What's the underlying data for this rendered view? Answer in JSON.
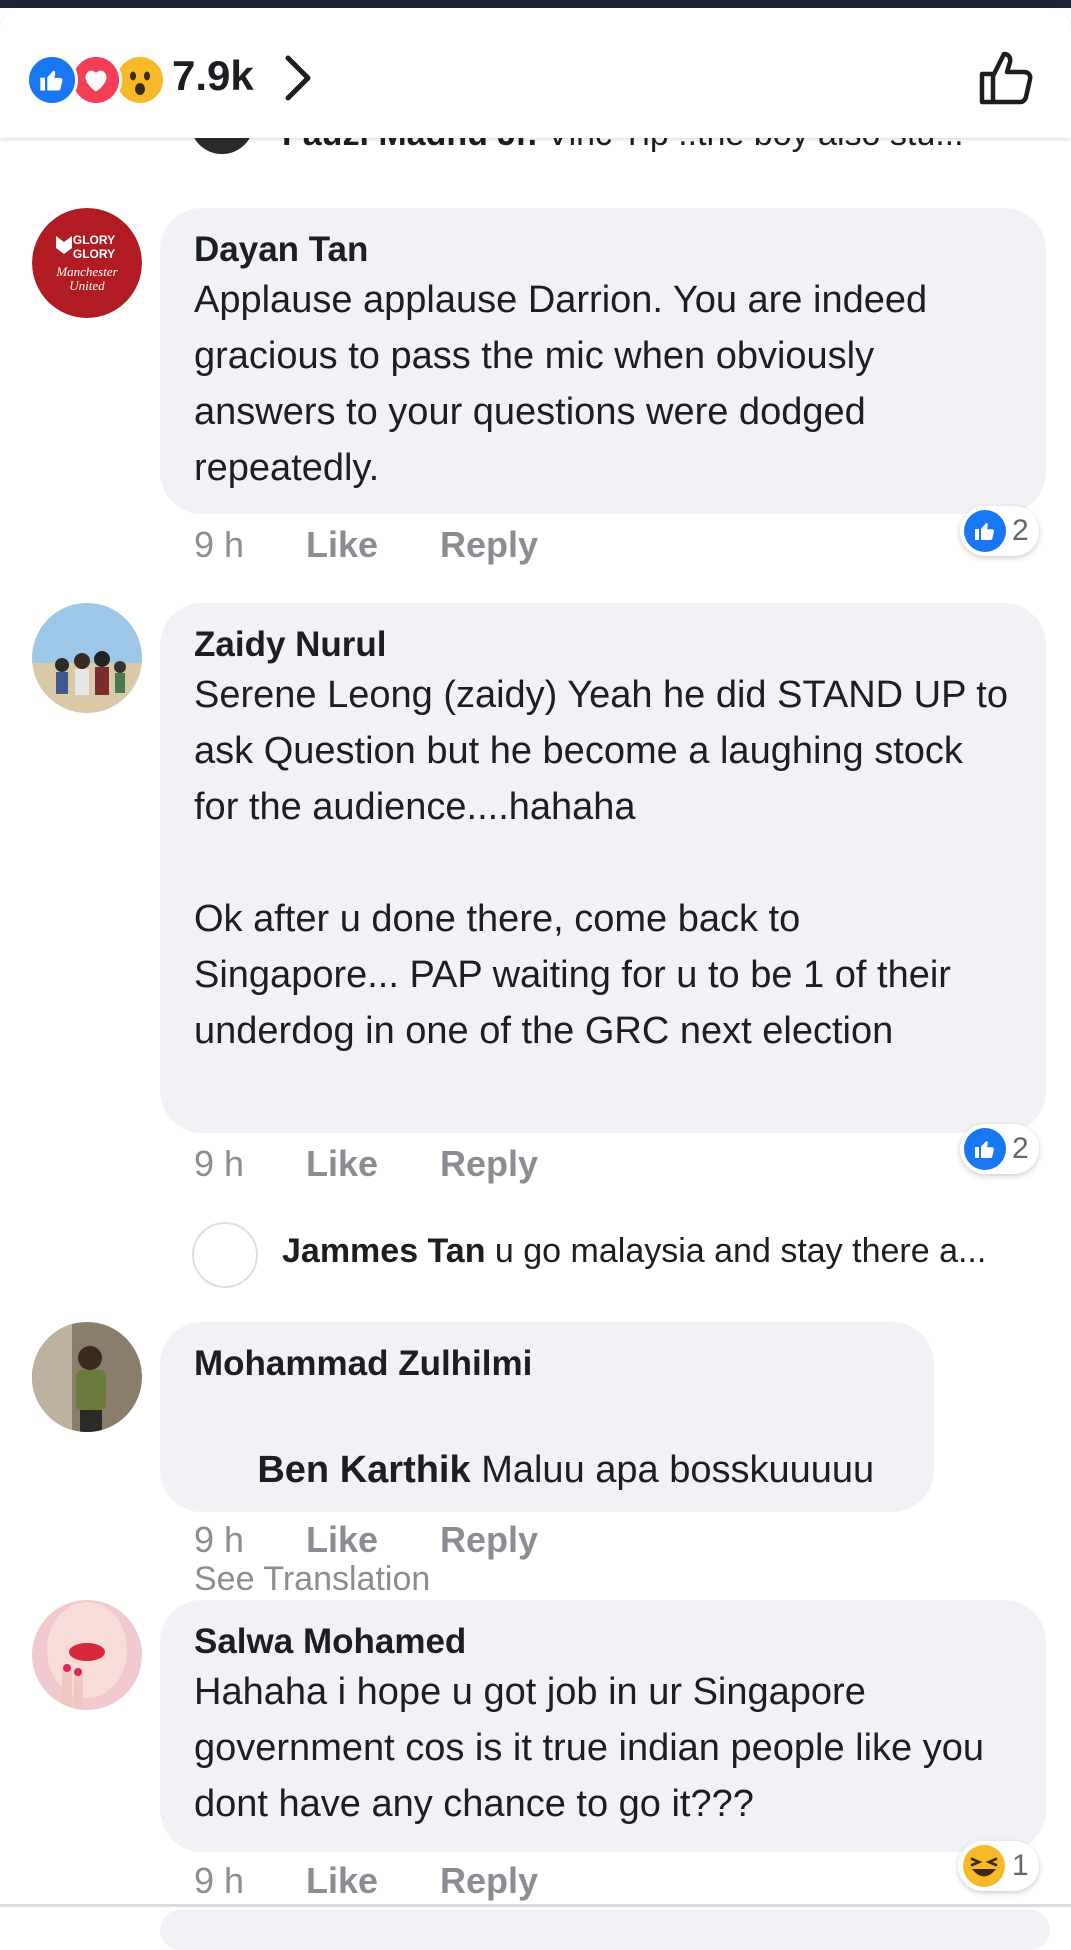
{
  "header": {
    "reaction_icons": [
      "like-icon",
      "love-icon",
      "wow-icon"
    ],
    "reaction_count": "7.9k"
  },
  "partial_reply": {
    "author": "Fauzi Madhu Jr.",
    "text": "Vinc Yip ..the boy also stu..."
  },
  "comments": [
    {
      "author": "Dayan Tan",
      "body": "Applause applause Darrion. You are indeed gracious to pass the mic when obviously answers to your questions were dodged repeatedly.",
      "time": "9 h",
      "like_label": "Like",
      "reply_label": "Reply",
      "reaction_count": "2",
      "avatar_text": [
        "GLORY",
        "GLORY",
        "Manchester",
        "United"
      ]
    },
    {
      "author": "Zaidy Nurul",
      "body": "Serene Leong (zaidy) Yeah he did STAND UP to ask Question but he become a laughing stock for the audience....hahaha\n\nOk after u done there, come back to Singapore... PAP waiting for u to be 1 of their underdog in one of the GRC next election",
      "time": "9 h",
      "like_label": "Like",
      "reply_label": "Reply",
      "reaction_count": "2"
    },
    {
      "author": "Mohammad Zulhilmi",
      "mention": "Ben Karthik",
      "body": " Maluu apa bosskuuuuu",
      "see_translation": "See Translation",
      "time": "9 h",
      "like_label": "Like",
      "reply_label": "Reply"
    },
    {
      "author": "Salwa Mohamed",
      "body": "Hahaha i hope u got job in ur Singapore government cos is it true indian people like you dont have any chance to go it???",
      "time": "9 h",
      "like_label": "Like",
      "reply_label": "Reply",
      "reaction_count": "1"
    }
  ],
  "reply_summary": {
    "author": "Jammes Tan",
    "text": "u go malaysia and stay there a..."
  },
  "colors": {
    "facebook_blue": "#1877f2",
    "love_red": "#f33e58",
    "wow_yellow": "#f7b928",
    "bubble_gray": "#f0f2f5",
    "meta_gray": "#8a8d91"
  }
}
